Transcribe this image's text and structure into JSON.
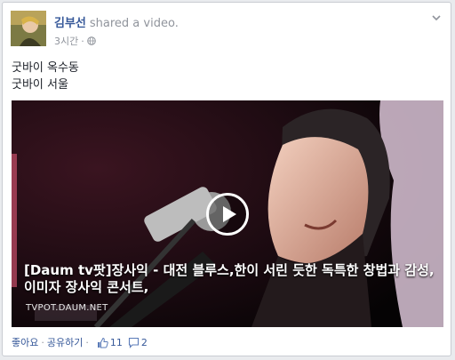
{
  "post": {
    "author": "김부선",
    "action": "shared a video.",
    "time": "3시간",
    "text_lines": [
      "굿바이 옥수동",
      "굿바이 서울"
    ]
  },
  "video": {
    "title": "[Daum tv팟]장사익 - 대전 블루스,한이 서린 듯한 독특한 창법과 감성,이미자 장사익 콘서트,",
    "source": "TVPOT.DAUM.NET"
  },
  "footer": {
    "like": "좋아요",
    "separator": "·",
    "share": "공유하기",
    "like_count": "11",
    "comment_count": "2"
  },
  "icons": {
    "globe": "globe-icon",
    "chevron": "chevron-down-icon",
    "thumb": "thumbs-up-icon",
    "comment": "comment-icon",
    "play": "play-icon"
  },
  "colors": {
    "author": "#365899",
    "meta": "#90949c",
    "text": "#1d2129"
  }
}
